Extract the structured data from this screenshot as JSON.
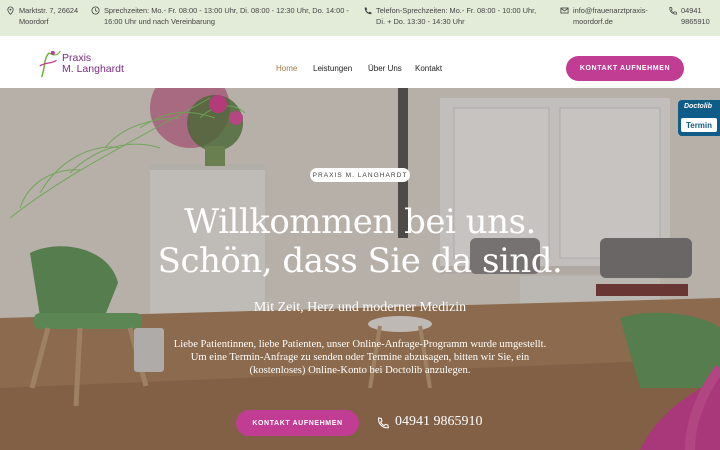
{
  "topbar": {
    "address_line1": "Marktstr. 7, 26624",
    "address_line2": "Moordorf",
    "hours_line1": "Sprechzeiten: Mo.- Fr. 08:00 - 13:00 Uhr, Di. 08:00 - 12:30 Uhr, Do. 14:00 -",
    "hours_line2": "16:00 Uhr und nach Vereinbarung",
    "phone_hours_line1": "Telefon-Sprechzeiten: Mo.- Fr. 08:00 - 10:00 Uhr,",
    "phone_hours_line2": "Di. + Do. 13:30 - 14:30 Uhr",
    "email_line1": "info@frauenarztpraxis-",
    "email_line2": "moordorf.de",
    "phone_line1": "04941",
    "phone_line2": "9865910"
  },
  "logo": {
    "line1": "Praxis",
    "line2": "M. Langhardt"
  },
  "nav": {
    "items": [
      {
        "label": "Home",
        "active": true
      },
      {
        "label": "Leistungen",
        "active": false
      },
      {
        "label": "Über Uns",
        "active": false
      },
      {
        "label": "Kontakt",
        "active": false
      }
    ],
    "cta_label": "KONTAKT AUFNEHMEN"
  },
  "hero": {
    "badge": "PRAXIS M. LANGHARDT",
    "headline_line1": "Willkommen bei uns.",
    "headline_line2": "Schön, dass Sie da sind.",
    "subtitle": "Mit Zeit, Herz und moderner Medizin",
    "info_line1": "Liebe Patientinnen, liebe Patienten, unser Online-Anfrage-Programm wurde umgestellt.",
    "info_line2": "Um eine Termin-Anfrage zu senden oder Termine abzusagen, bitten wir Sie, ein",
    "info_line3": "(kostenloses) Online-Konto bei Doctolib anzulegen.",
    "cta_label": "KONTAKT AUFNEHMEN",
    "phone": "04941 9865910"
  },
  "doctolib": {
    "brand": "Doctolib",
    "label": "Termin"
  },
  "colors": {
    "accent": "#c13c93",
    "topbar_bg": "#e3ecd9",
    "logo_purple": "#7a2a80",
    "logo_green": "#6fb23a",
    "doctolib_blue": "#0f5c89"
  }
}
